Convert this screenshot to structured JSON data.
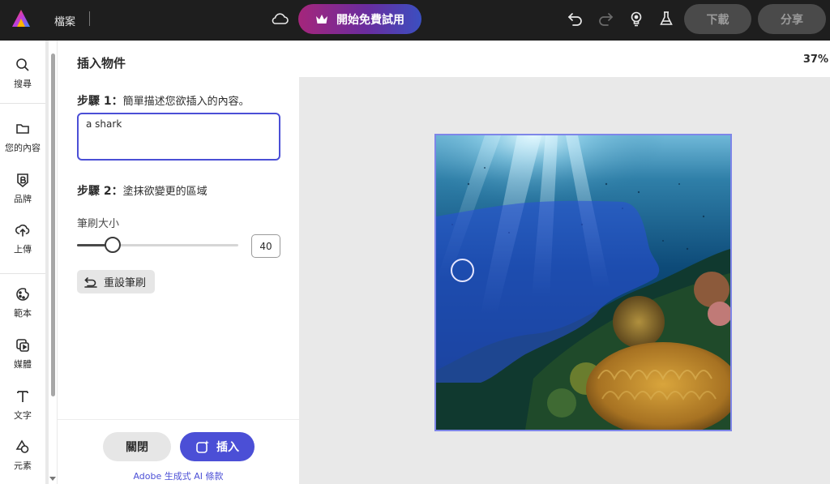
{
  "topbar": {
    "file_menu": "檔案",
    "trial_button": "開始免費試用",
    "download_button": "下載",
    "share_button": "分享",
    "icons": [
      "adobe-express-logo",
      "cloud-icon",
      "crown-icon",
      "undo-icon",
      "redo-icon",
      "lightbulb-icon",
      "flask-icon"
    ]
  },
  "rail": {
    "items": [
      {
        "label": "搜尋",
        "icon": "search-icon"
      },
      {
        "label": "您的內容",
        "icon": "folder-icon"
      },
      {
        "label": "品牌",
        "icon": "brand-icon"
      },
      {
        "label": "上傳",
        "icon": "upload-icon"
      },
      {
        "label": "範本",
        "icon": "template-icon"
      },
      {
        "label": "媒體",
        "icon": "media-icon"
      },
      {
        "label": "文字",
        "icon": "text-icon"
      },
      {
        "label": "元素",
        "icon": "shapes-icon"
      }
    ]
  },
  "panel": {
    "title": "插入物件",
    "step1_label": "步驟 1：",
    "step1_text": "簡單描述您欲插入的內容。",
    "prompt_value": "a shark",
    "step2_label": "步驟 2：",
    "step2_text": "塗抹欲變更的區域",
    "brush_size_label": "筆刷大小",
    "brush_size_value": "40",
    "brush_slider_fraction": 0.22,
    "reset_brush_label": "重設筆刷",
    "close_button": "關閉",
    "insert_button": "插入",
    "terms_link": "Adobe 生成式 AI 條款"
  },
  "canvas": {
    "zoom": "37%"
  },
  "colors": {
    "accent": "#4b4fd6",
    "topbar": "#1e1e1e",
    "trial_gradient_start": "#a5267b",
    "trial_gradient_end": "#3b4fc0"
  }
}
